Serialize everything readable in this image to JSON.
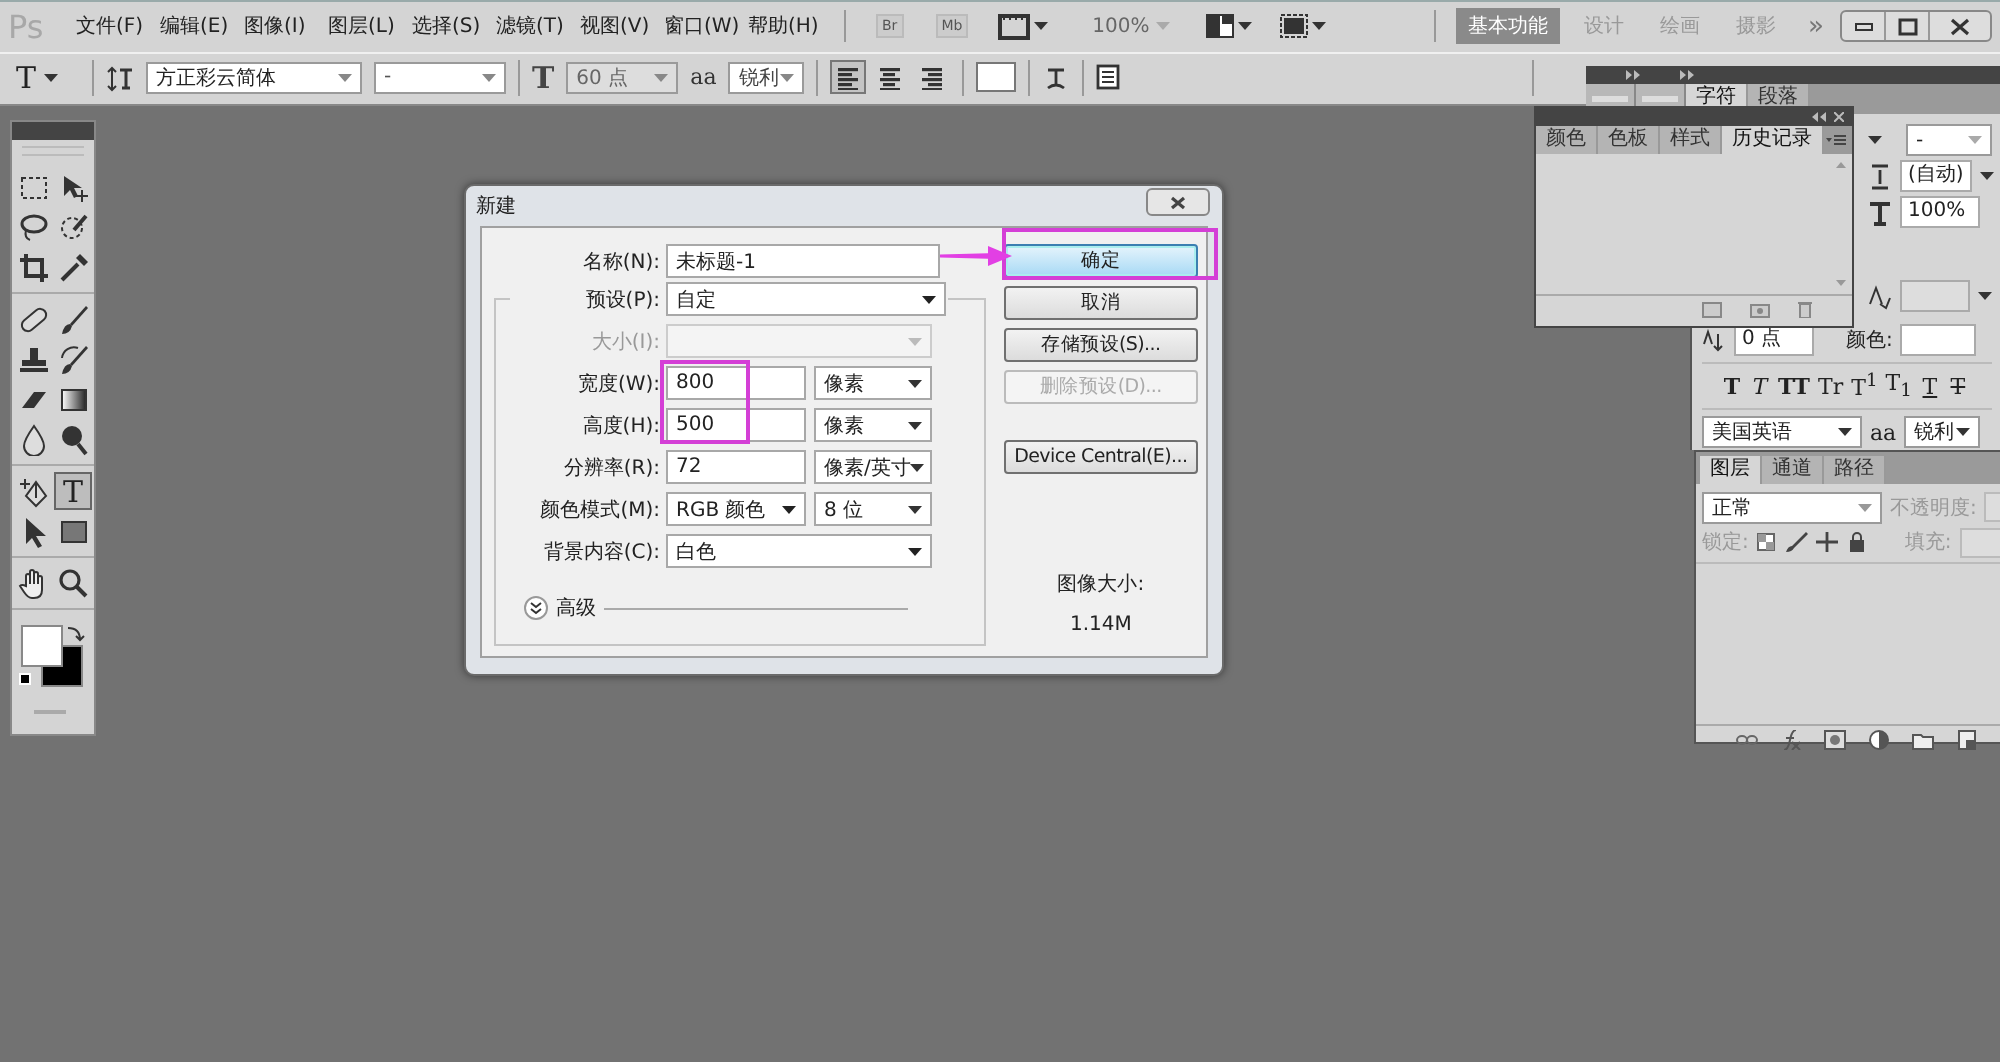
{
  "app_bar": {
    "logo": "Ps",
    "menus": [
      "文件(F)",
      "编辑(E)",
      "图像(I)",
      "图层(L)",
      "选择(S)",
      "滤镜(T)",
      "视图(V)",
      "窗口(W)",
      "帮助(H)"
    ],
    "bridge": "Br",
    "mini_bridge": "Mb",
    "zoom": "100%",
    "workspaces": [
      {
        "label": "基本功能",
        "selected": true
      },
      {
        "label": "设计",
        "selected": false
      },
      {
        "label": "绘画",
        "selected": false
      },
      {
        "label": "摄影",
        "selected": false
      }
    ],
    "more": "»"
  },
  "options_bar": {
    "tool": "T",
    "font_family": "方正彩云简体",
    "font_style": "-",
    "size_symbol": "T",
    "font_size": "60 点",
    "antialias_symbol": "aa",
    "antialias": "锐利",
    "align": [
      {
        "selected": true
      },
      {
        "selected": false
      },
      {
        "selected": false
      }
    ]
  },
  "toolbox": {
    "groups": [
      {
        "tools": [
          {
            "kind": "marquee",
            "selected": false
          },
          {
            "kind": "move",
            "selected": false
          },
          {
            "kind": "lasso",
            "selected": false
          },
          {
            "kind": "quick-select",
            "selected": false
          },
          {
            "kind": "crop",
            "selected": false
          },
          {
            "kind": "eyedropper",
            "selected": false
          }
        ]
      },
      {
        "tools": [
          {
            "kind": "healing",
            "selected": false
          },
          {
            "kind": "brush",
            "selected": false
          },
          {
            "kind": "stamp",
            "selected": false
          },
          {
            "kind": "history-brush",
            "selected": false
          },
          {
            "kind": "eraser",
            "selected": false
          },
          {
            "kind": "gradient",
            "selected": false
          },
          {
            "kind": "blur",
            "selected": false
          },
          {
            "kind": "dodge",
            "selected": false
          }
        ]
      },
      {
        "tools": [
          {
            "kind": "pen",
            "selected": false
          },
          {
            "kind": "type",
            "label": "T",
            "selected": true
          },
          {
            "kind": "path-select",
            "selected": false
          },
          {
            "kind": "shape",
            "selected": false
          }
        ]
      },
      {
        "tools": [
          {
            "kind": "hand",
            "selected": false
          },
          {
            "kind": "zoom",
            "selected": false
          }
        ]
      }
    ]
  },
  "character_panel": {
    "tabs": [
      {
        "label": "字符",
        "selected": true
      },
      {
        "label": "段落",
        "selected": false
      }
    ],
    "font_style": "-",
    "leading": "(自动)",
    "vertical_scale": "100%",
    "baseline_shift": "0 点",
    "color_label": "颜色:",
    "styles": [
      {
        "kind": "bold",
        "label": "T"
      },
      {
        "kind": "italic",
        "label": "T"
      },
      {
        "kind": "caps",
        "label": "TT"
      },
      {
        "kind": "small-caps",
        "label": "Tr"
      },
      {
        "kind": "super",
        "label": "T$^{1}$"
      },
      {
        "kind": "sub",
        "label": "T$_{1}$"
      },
      {
        "kind": "underline",
        "label": "T"
      },
      {
        "kind": "strike",
        "label": "T"
      }
    ],
    "language": "美国英语",
    "antialias_symbol": "aa",
    "antialias": "锐利"
  },
  "history_panel": {
    "tabs": [
      {
        "label": "颜色",
        "selected": false
      },
      {
        "label": "色板",
        "selected": false
      },
      {
        "label": "样式",
        "selected": false
      },
      {
        "label": "历史记录",
        "selected": true
      }
    ]
  },
  "layers_panel": {
    "tabs": [
      {
        "label": "图层",
        "selected": true
      },
      {
        "label": "通道",
        "selected": false
      },
      {
        "label": "路径",
        "selected": false
      }
    ],
    "blend_mode": "正常",
    "opacity_label": "不透明度:",
    "lock_label": "锁定:",
    "fill_label": "填充:"
  },
  "dialog": {
    "title": "新建",
    "name_label": "名称(N):",
    "name_value": "未标题-1",
    "fields": [
      {
        "label": "预设(P):",
        "value": "自定",
        "kind": "select",
        "disabled": false
      },
      {
        "label": "大小(I):",
        "kind": "select",
        "disabled": true
      },
      {
        "label": "宽度(W):",
        "value": "800",
        "kind": "text",
        "unit": "像素",
        "disabled": false
      },
      {
        "label": "高度(H):",
        "value": "500",
        "kind": "text",
        "unit": "像素",
        "disabled": false
      },
      {
        "label": "分辨率(R):",
        "value": "72",
        "kind": "text",
        "unit": "像素/英寸",
        "disabled": false
      },
      {
        "label": "颜色模式(M):",
        "value": "RGB 颜色",
        "kind": "select",
        "unit": "8 位",
        "disabled": false
      },
      {
        "label": "背景内容(C):",
        "value": "白色",
        "kind": "select",
        "disabled": false
      }
    ],
    "advanced": "高级",
    "buttons": [
      {
        "label": "确定",
        "kind": "default",
        "disabled": false
      },
      {
        "label": "取消",
        "kind": "normal",
        "disabled": false
      },
      {
        "label": "存储预设(S)...",
        "kind": "normal",
        "disabled": false
      },
      {
        "label": "删除预设(D)...",
        "kind": "normal",
        "disabled": true
      },
      {
        "label": "Device Central(E)...",
        "kind": "separate",
        "disabled": false
      }
    ],
    "image_size_label": "图像大小:",
    "image_size": "1.14M"
  }
}
